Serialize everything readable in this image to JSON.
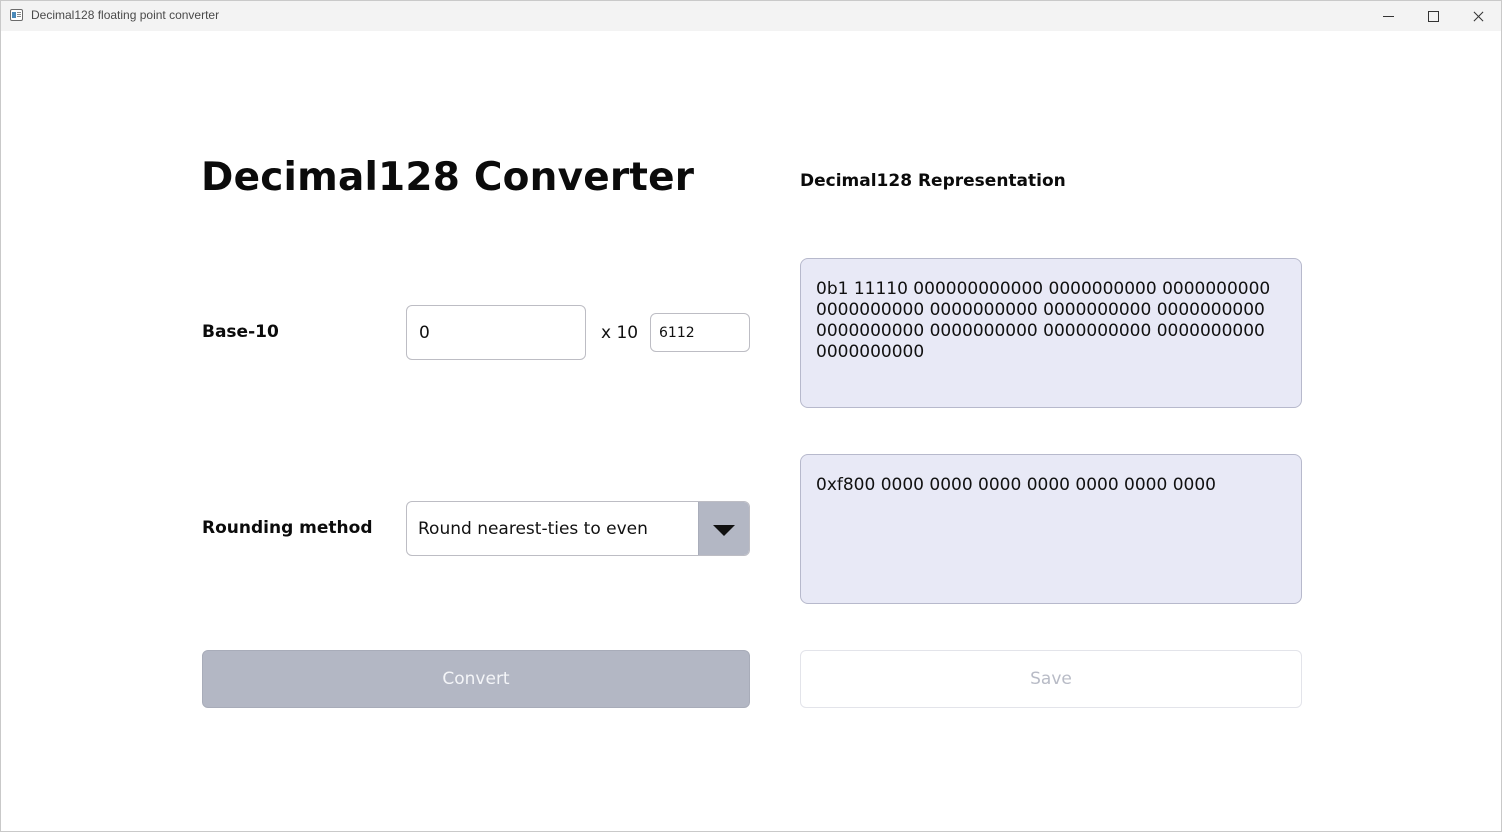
{
  "window": {
    "title": "Decimal128 floating point converter",
    "icon": "app-icon",
    "controls": [
      "minimize-icon",
      "maximize-icon",
      "close-icon"
    ]
  },
  "main": {
    "title": "Decimal128 Converter",
    "base10": {
      "label": "Base-10",
      "mantissa_value": "0",
      "times_ten": "x 10",
      "exponent_value": "6112"
    },
    "rounding": {
      "label": "Rounding method",
      "selected": "Round nearest-ties to even"
    },
    "convert_label": "Convert"
  },
  "representation": {
    "title": "Decimal128 Representation",
    "binary": "0b1 11110 000000000000 0000000000 0000000000 0000000000 0000000000 0000000000 0000000000 0000000000 0000000000 0000000000 0000000000 0000000000",
    "hex": "0xf800 0000 0000 0000 0000 0000 0000 0000",
    "save_label": "Save"
  },
  "colors": {
    "output_background": "#e8e9f6",
    "disabled_button": "#b3b7c4"
  }
}
